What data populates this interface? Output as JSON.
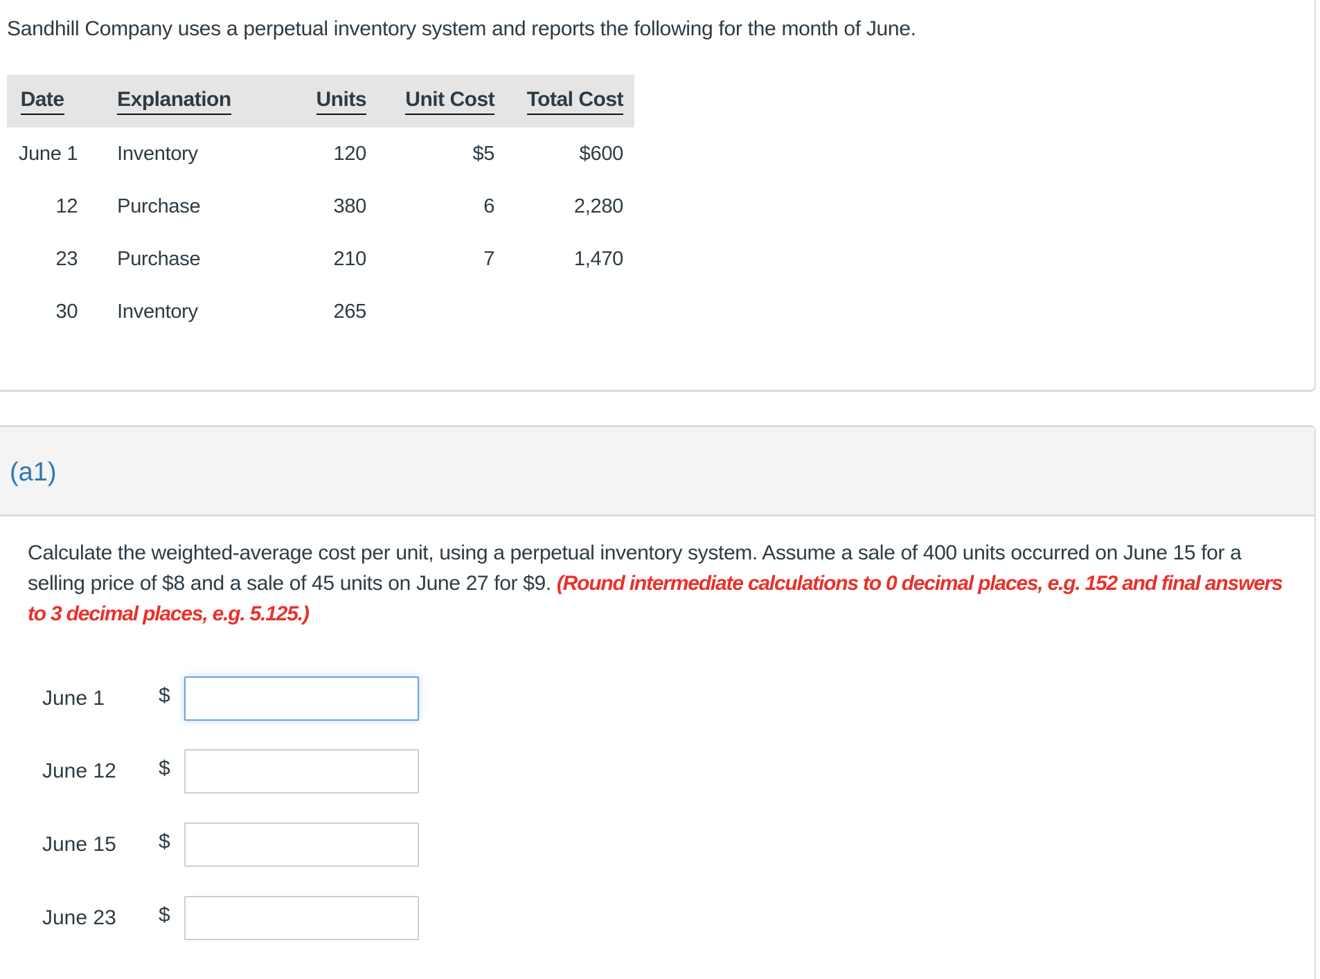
{
  "problem": {
    "intro": "Sandhill Company uses a perpetual inventory system and reports the following for the month of June."
  },
  "inventory_table": {
    "headers": [
      "Date",
      "Explanation",
      "Units",
      "Unit Cost",
      "Total Cost"
    ],
    "rows": [
      {
        "date": "June 1",
        "explanation": "Inventory",
        "units": "120",
        "unit_cost": "$5",
        "total_cost": "$600"
      },
      {
        "date": "12",
        "explanation": "Purchase",
        "units": "380",
        "unit_cost": "6",
        "total_cost": "2,280"
      },
      {
        "date": "23",
        "explanation": "Purchase",
        "units": "210",
        "unit_cost": "7",
        "total_cost": "1,470"
      },
      {
        "date": "30",
        "explanation": "Inventory",
        "units": "265",
        "unit_cost": "",
        "total_cost": ""
      }
    ]
  },
  "part": {
    "label": "(a1)",
    "instructions": "Calculate the weighted-average cost per unit, using a perpetual inventory system. Assume a sale of 400 units occurred on June 15 for a selling price of $8 and a sale of 45 units on June 27 for $9. ",
    "rounding_note": "(Round intermediate calculations to 0 decimal places, e.g. 152 and final answers to 3 decimal places, e.g. 5.125.)",
    "colors": {
      "label": "#3177ad",
      "note": "#e8322a",
      "focus_border": "#6fa3dd"
    },
    "answers": [
      {
        "label": "June 1",
        "currency": "$",
        "value": ""
      },
      {
        "label": "June 12",
        "currency": "$",
        "value": ""
      },
      {
        "label": "June 15",
        "currency": "$",
        "value": ""
      },
      {
        "label": "June 23",
        "currency": "$",
        "value": ""
      }
    ]
  }
}
